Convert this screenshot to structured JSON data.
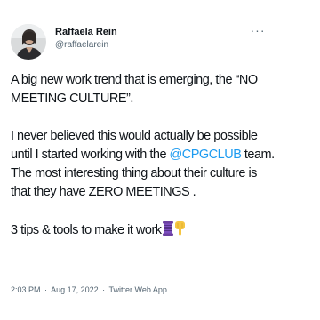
{
  "author": {
    "display_name": "Raffaela Rein",
    "handle": "@raffaelarein",
    "avatar_icon": "profile-photo-avatar"
  },
  "more_icon": "more-horizontal-icon",
  "tweet": {
    "para1": "A big new work trend that is emerging, the “NO MEETING CULTURE”.",
    "para2_before": "I never believed this would actually be possible until I started working with the ",
    "mention": "@CPGCLUB",
    "para2_after": " team. The most interesting thing about their culture is that they have ZERO MEETINGS .",
    "para3": "3 tips & tools to make it work",
    "emoji_icons": [
      "thread-spool-emoji",
      "pointing-down-hand-emoji"
    ]
  },
  "meta": {
    "time": "2:03 PM",
    "separator": "·",
    "date": "Aug 17, 2022",
    "source": "Twitter Web App"
  },
  "colors": {
    "text": "#0f1419",
    "secondary": "#536471",
    "link": "#1d9bf0"
  }
}
